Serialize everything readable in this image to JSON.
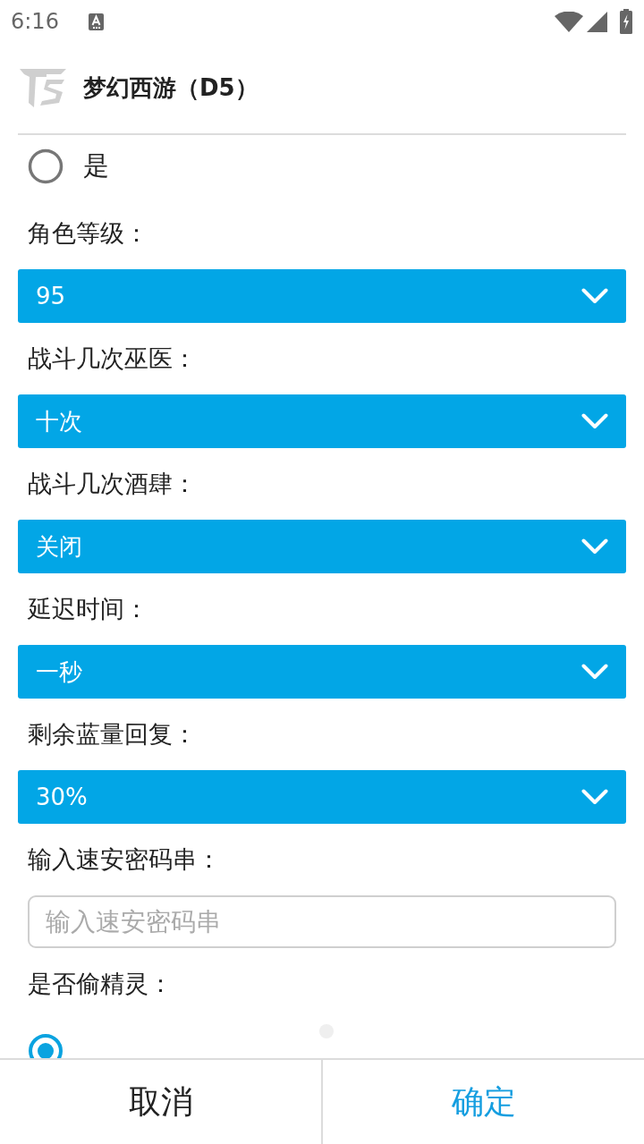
{
  "status_bar": {
    "time": "6:16"
  },
  "header": {
    "title": "梦幻西游（D5）"
  },
  "form": [
    {
      "kind": "radio_group",
      "options": [
        {
          "label": "是",
          "selected": false
        }
      ]
    },
    {
      "kind": "select",
      "label": "角色等级：",
      "value": "95"
    },
    {
      "kind": "select",
      "label": "战斗几次巫医：",
      "value": "十次"
    },
    {
      "kind": "select",
      "label": "战斗几次酒肆：",
      "value": "关闭"
    },
    {
      "kind": "select",
      "label": "延迟时间：",
      "value": "一秒"
    },
    {
      "kind": "select",
      "label": "剩余蓝量回复：",
      "value": "30%"
    },
    {
      "kind": "text_input",
      "label": "输入速安密码串：",
      "placeholder": "输入速安密码串"
    },
    {
      "kind": "radio_group",
      "label": "是否偷精灵：",
      "options": [
        {
          "selected": true
        }
      ]
    }
  ],
  "footer": {
    "buttons": [
      {
        "kind": "cancel",
        "label": "取消"
      },
      {
        "kind": "confirm",
        "label": "确定"
      }
    ]
  }
}
